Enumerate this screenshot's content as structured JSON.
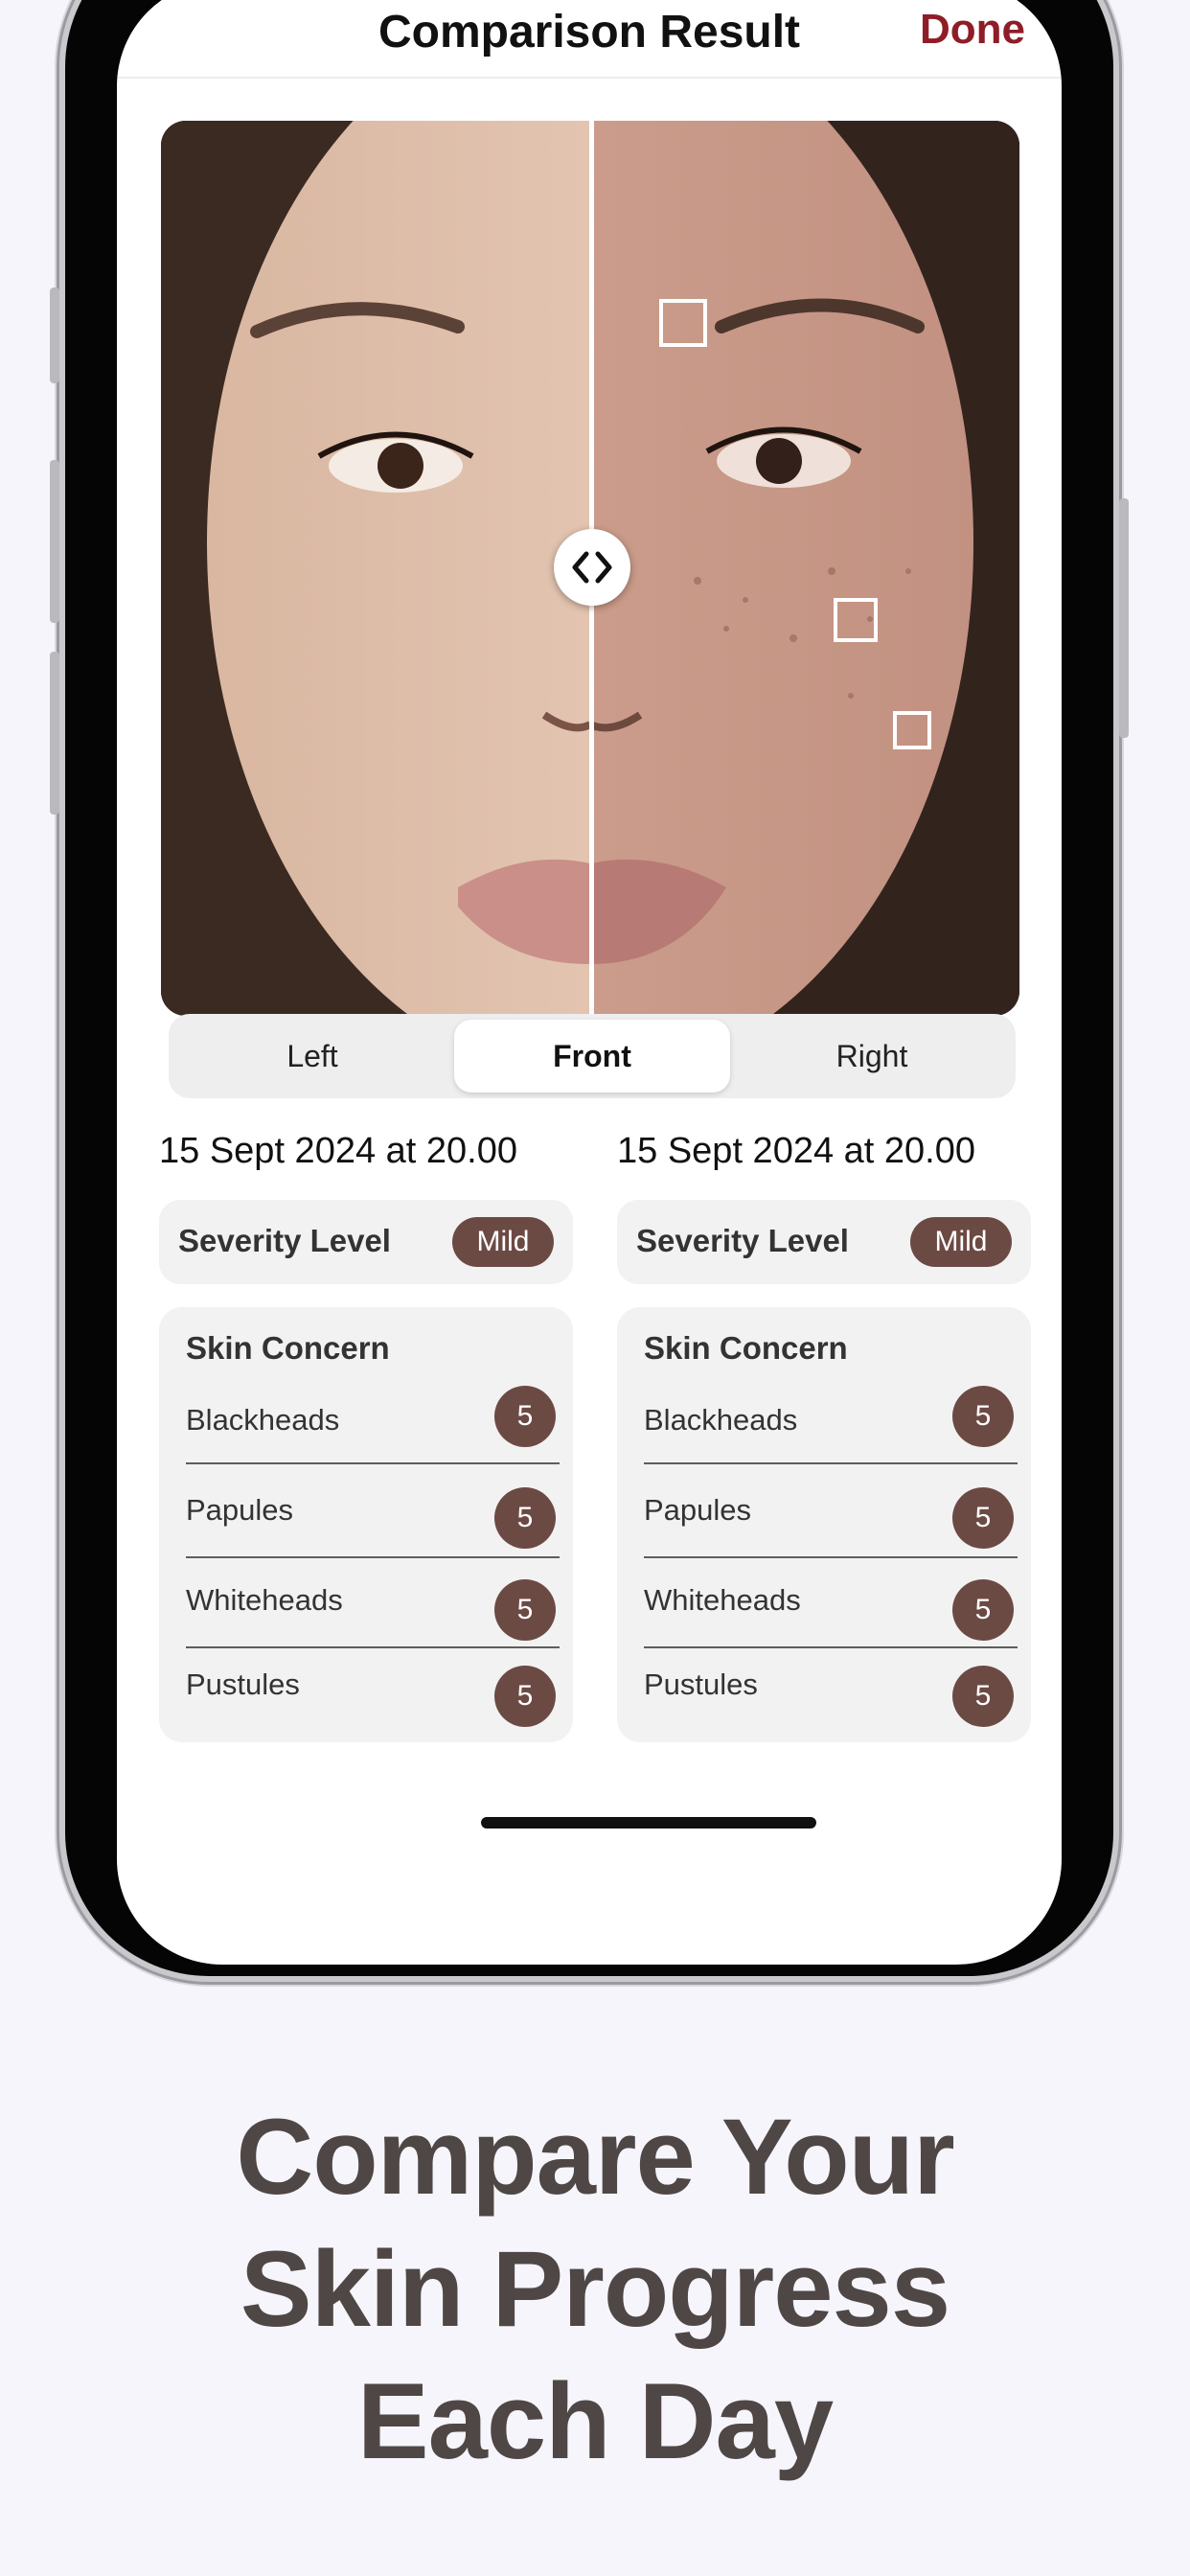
{
  "nav": {
    "title": "Comparison Result",
    "done_label": "Done"
  },
  "comparison_view": {
    "handle_icon": "chevron-left-right-icon",
    "marker_count": 3
  },
  "view_tabs": [
    {
      "label": "Left",
      "active": false
    },
    {
      "label": "Front",
      "active": true
    },
    {
      "label": "Right",
      "active": false
    }
  ],
  "left_result": {
    "date": "15 Sept 2024 at 20.00",
    "severity_label": "Severity Level",
    "severity_value": "Mild",
    "concern_title": "Skin Concern",
    "concerns": [
      {
        "name": "Blackheads",
        "count": "5"
      },
      {
        "name": "Papules",
        "count": "5"
      },
      {
        "name": "Whiteheads",
        "count": "5"
      },
      {
        "name": "Pustules",
        "count": "5"
      }
    ]
  },
  "right_result": {
    "date": "15 Sept 2024 at 20.00",
    "severity_label": "Severity Level",
    "severity_value": "Mild",
    "concern_title": "Skin Concern",
    "concerns": [
      {
        "name": "Blackheads",
        "count": "5"
      },
      {
        "name": "Papules",
        "count": "5"
      },
      {
        "name": "Whiteheads",
        "count": "5"
      },
      {
        "name": "Pustules",
        "count": "5"
      }
    ]
  },
  "caption": {
    "line1": "Compare Your",
    "line2": "Skin Progress",
    "line3": "Each Day"
  },
  "colors": {
    "accent": "#8f1d27",
    "badge": "#6c4a44",
    "caption": "#4f4745",
    "background": "#f6f5fb"
  }
}
